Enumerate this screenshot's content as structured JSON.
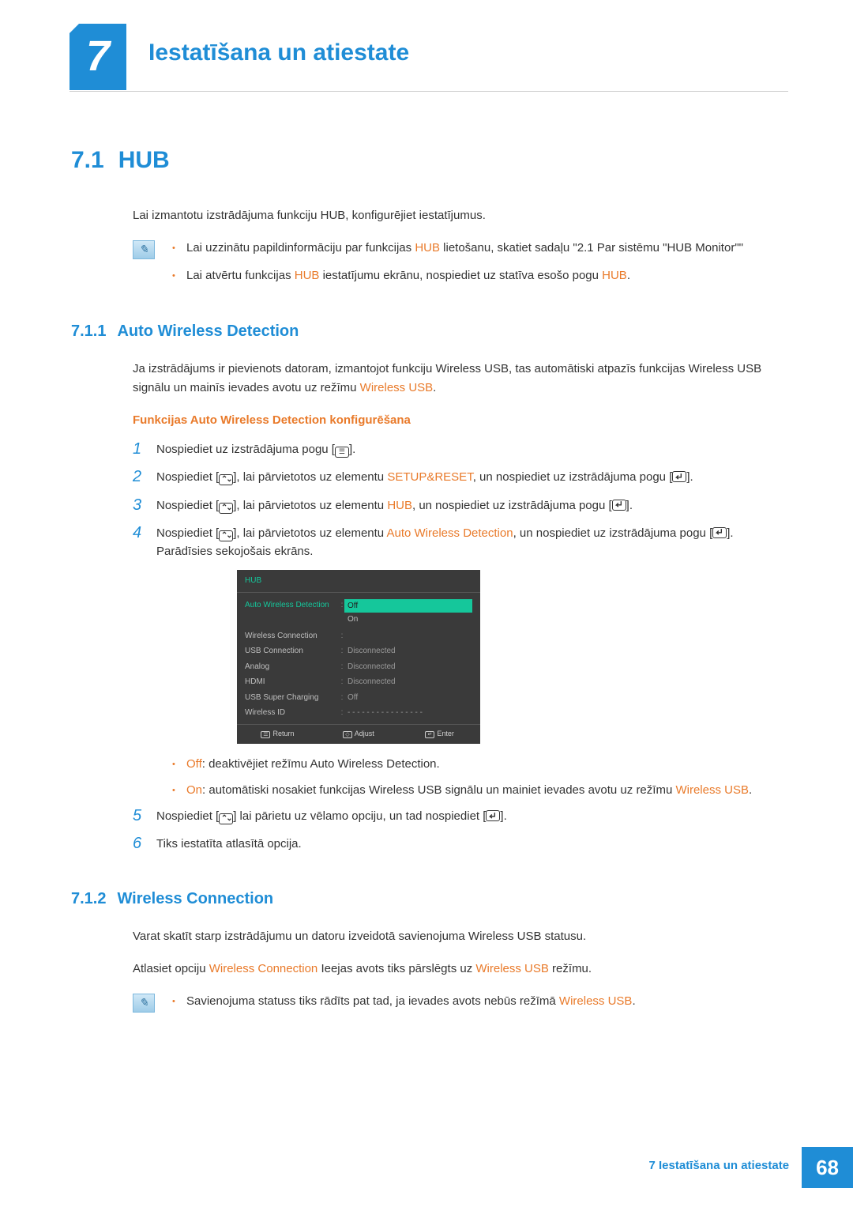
{
  "chapter": {
    "number": "7",
    "title": "Iestatīšana un atiestate"
  },
  "section": {
    "number": "7.1",
    "title": "HUB"
  },
  "intro": "Lai izmantotu izstrādājuma funkciju HUB, konfigurējiet iestatījumus.",
  "note1": {
    "i1a": "Lai uzzinātu papildinformāciju par funkcijas ",
    "i1b": "HUB",
    "i1c": " lietošanu, skatiet sadaļu \"2.1 Par sistēmu \"HUB Monitor\"\"",
    "i2a": "Lai atvērtu funkcijas ",
    "i2b": "HUB",
    "i2c": " iestatījumu ekrānu, nospiediet uz statīva esošo pogu ",
    "i2d": "HUB",
    "i2e": "."
  },
  "sub1": {
    "number": "7.1.1",
    "title": "Auto Wireless Detection"
  },
  "sub1_p_a": "Ja izstrādājums ir pievienots datoram, izmantojot funkciju Wireless USB, tas automātiski atpazīs funkcijas Wireless USB signālu un mainīs ievades avotu uz režīmu ",
  "sub1_p_b": "Wireless USB",
  "sub1_p_c": ".",
  "conf_h": "Funkcijas Auto Wireless Detection konfigurēšana",
  "steps": {
    "s1": "Nospiediet uz izstrādājuma pogu [",
    "s1_end": "].",
    "s2a": "Nospiediet [",
    "s2b": "], lai pārvietotos uz elementu ",
    "s2c": "SETUP&RESET",
    "s2d": ", un nospiediet uz izstrādājuma pogu [",
    "s2e": "].",
    "s3a": "Nospiediet [",
    "s3b": "], lai pārvietotos uz elementu ",
    "s3c": "HUB",
    "s3d": ", un nospiediet uz izstrādājuma pogu [",
    "s3e": "].",
    "s4a": "Nospiediet [",
    "s4b": "], lai pārvietotos uz elementu ",
    "s4c": "Auto Wireless Detection",
    "s4d": ", un nospiediet uz izstrādājuma pogu [",
    "s4e": "]. Parādīsies sekojošais ekrāns.",
    "s5a": "Nospiediet [",
    "s5b": "] lai pārietu uz vēlamo opciju, un tad nospiediet [",
    "s5c": "].",
    "s6": "Tiks iestatīta atlasītā opcija."
  },
  "osd": {
    "title": "HUB",
    "rows": [
      {
        "label": "Auto Wireless Detection",
        "selected": true,
        "options": [
          "Off",
          "On"
        ],
        "active": 0
      },
      {
        "label": "Wireless Connection",
        "value": ""
      },
      {
        "label": "USB Connection",
        "value": "Disconnected"
      },
      {
        "label": "Analog",
        "value": "Disconnected"
      },
      {
        "label": "HDMI",
        "value": "Disconnected"
      },
      {
        "label": "USB Super Charging",
        "value": "Off"
      },
      {
        "label": "Wireless ID",
        "value": "- - - - - - - - - - - - - - - -"
      }
    ],
    "footer": {
      "return": "Return",
      "adjust": "Adjust",
      "enter": "Enter"
    }
  },
  "opts": {
    "off_l": "Off",
    "off_t": ": deaktivējiet režīmu Auto Wireless Detection.",
    "on_l": "On",
    "on_ta": ": automātiski nosakiet funkcijas Wireless USB signālu un mainiet ievades avotu uz režīmu ",
    "on_tb": "Wireless USB",
    "on_tc": "."
  },
  "sub2": {
    "number": "7.1.2",
    "title": "Wireless Connection"
  },
  "sub2_p1": "Varat skatīt starp izstrādājumu un datoru izveidotā savienojuma Wireless USB statusu.",
  "sub2_p2a": "Atlasiet opciju ",
  "sub2_p2b": "Wireless Connection",
  "sub2_p2c": " Ieejas avots tiks pārslēgts uz ",
  "sub2_p2d": "Wireless USB",
  "sub2_p2e": " režīmu.",
  "note2a": "Savienojuma statuss tiks rādīts pat tad, ja ievades avots nebūs režīmā ",
  "note2b": "Wireless USB",
  "note2c": ".",
  "footer": {
    "chapter_num": "7",
    "chapter_title": "Iestatīšana un atiestate",
    "page": "68"
  }
}
